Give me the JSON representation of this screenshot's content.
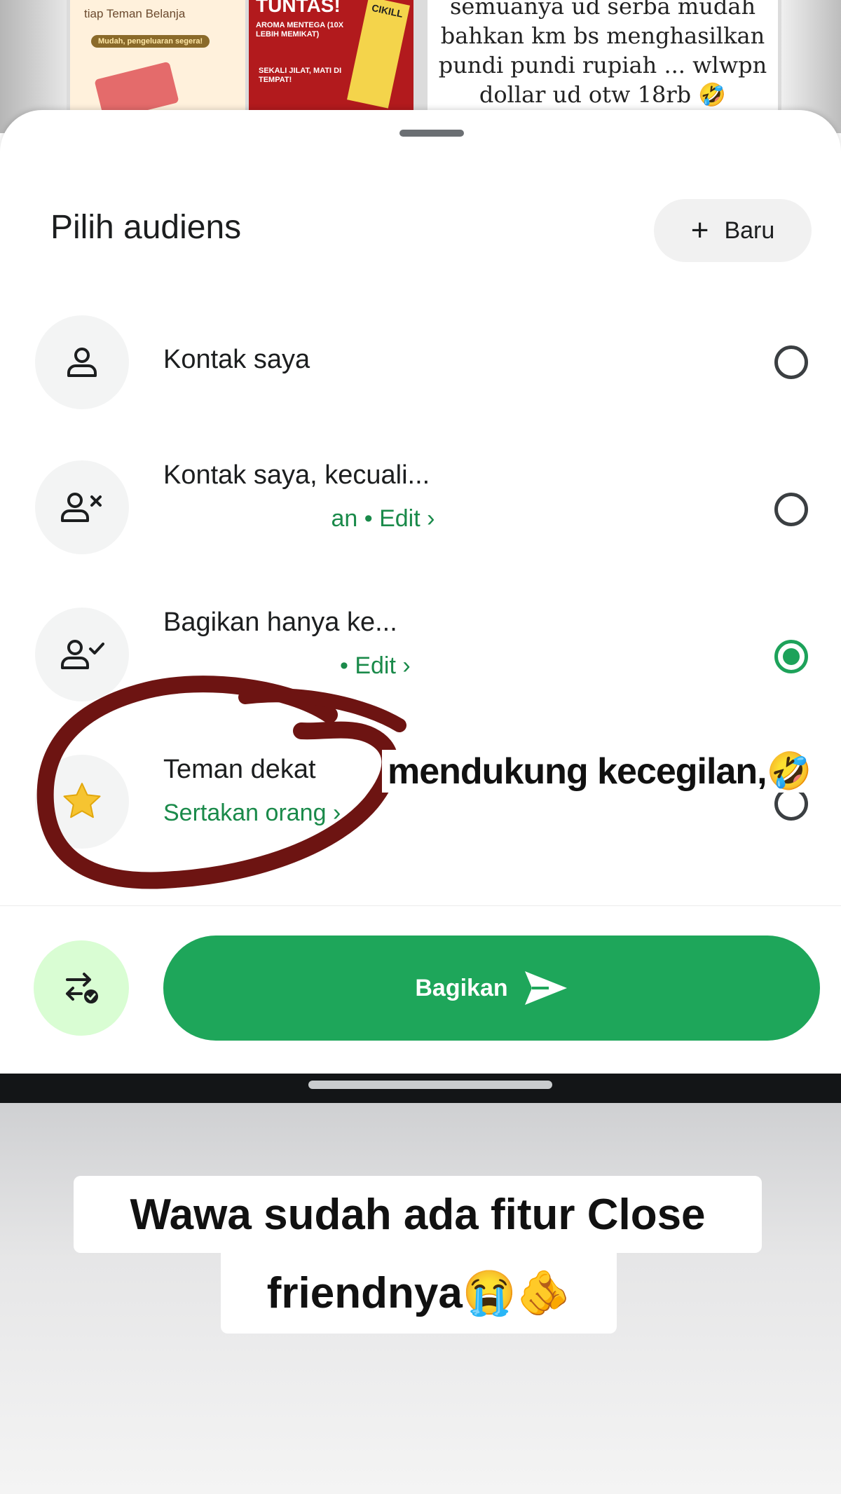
{
  "background_post": {
    "ad_left_text": "tiap Teman Belanja",
    "ad_left_badge": "Mudah, pengeluaran segera!",
    "ad_mid_title": "TUNTAS!",
    "ad_mid_sub": "AROMA MENTEGA (10X LEBIH MEMIKAT)",
    "ad_mid_tag": "SEKALI JILAT, MATI DI TEMPAT!",
    "ad_mid_product": "CIKILL",
    "post_lines": [
      "semuanya ud serba mudah",
      "bahkan km bs menghasilkan",
      "pundi pundi rupiah ... wlwpn",
      "dollar ud otw 18rb 🤣"
    ]
  },
  "sheet": {
    "title": "Pilih audiens",
    "new_button_label": "Baru",
    "options": [
      {
        "label": "Kontak saya",
        "sub": "",
        "icon": "person-icon",
        "selected": false
      },
      {
        "label": "Kontak saya, kecuali...",
        "sub": "an • Edit",
        "icon": "person-x-icon",
        "selected": false
      },
      {
        "label": "Bagikan hanya ke...",
        "sub": "• Edit",
        "icon": "person-check-icon",
        "selected": true
      },
      {
        "label": "Teman dekat",
        "sub": "Sertakan orang",
        "icon": "star-icon",
        "selected": false
      }
    ],
    "share_button_label": "Bagikan"
  },
  "overlay": {
    "annotation_text": "mendukung kecegilan,🤣",
    "caption_line1": "Wawa sudah ada fitur Close",
    "caption_line2": "friendnya😭🫵"
  },
  "colors": {
    "accent_green": "#1ea65a",
    "annotation_red": "#6d1412"
  }
}
